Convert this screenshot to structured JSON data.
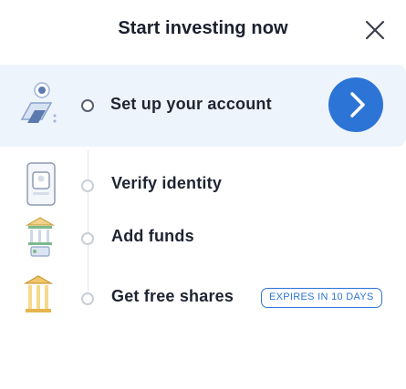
{
  "header": {
    "title": "Start investing now",
    "close_icon": "close-icon"
  },
  "steps": [
    {
      "label": "Set up your account",
      "icon": "account-setup-illustration",
      "active": true
    },
    {
      "label": "Verify identity",
      "icon": "identity-document-illustration",
      "active": false
    },
    {
      "label": "Add funds",
      "icon": "bank-funds-illustration",
      "active": false
    },
    {
      "label": "Get free shares",
      "icon": "stock-shares-illustration",
      "active": false,
      "badge": "EXPIRES IN 10 DAYS"
    }
  ],
  "colors": {
    "accent": "#2d74d7",
    "active_row_bg": "#eef4fb",
    "text": "#1f2433"
  },
  "go_button_icon": "chevron-right-icon"
}
